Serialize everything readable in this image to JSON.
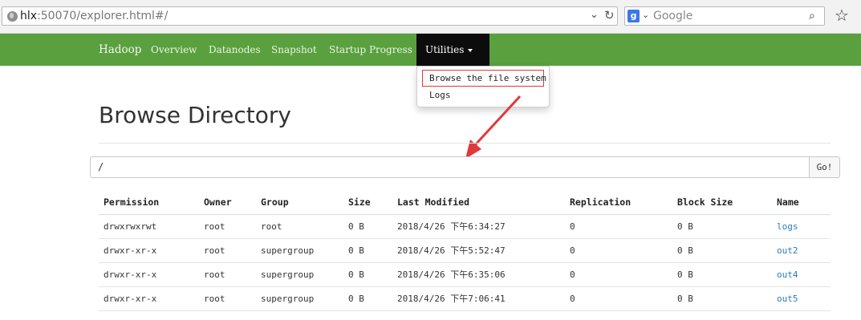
{
  "browser": {
    "url_host": "hlx",
    "url_rest": ":50070/explorer.html#/",
    "search_placeholder": "Google",
    "search_engine_icon": "google-icon"
  },
  "navbar": {
    "brand": "Hadoop",
    "items": [
      {
        "label": "Overview"
      },
      {
        "label": "Datanodes"
      },
      {
        "label": "Snapshot"
      },
      {
        "label": "Startup Progress"
      },
      {
        "label": "Utilities",
        "active": true
      }
    ],
    "color": "#5aa03f"
  },
  "dropdown": {
    "items": [
      {
        "label": "Browse the file system",
        "highlighted": true
      },
      {
        "label": "Logs"
      }
    ]
  },
  "main": {
    "title": "Browse Directory",
    "path_value": "/",
    "go_label": "Go!",
    "columns": [
      "Permission",
      "Owner",
      "Group",
      "Size",
      "Last Modified",
      "Replication",
      "Block Size",
      "Name"
    ],
    "rows": [
      [
        "drwxrwxrwt",
        "root",
        "root",
        "0 B",
        "2018/4/26 下午6:34:27",
        "0",
        "0 B",
        "logs"
      ],
      [
        "drwxr-xr-x",
        "root",
        "supergroup",
        "0 B",
        "2018/4/26 下午5:52:47",
        "0",
        "0 B",
        "out2"
      ],
      [
        "drwxr-xr-x",
        "root",
        "supergroup",
        "0 B",
        "2018/4/26 下午6:35:06",
        "0",
        "0 B",
        "out4"
      ],
      [
        "drwxr-xr-x",
        "root",
        "supergroup",
        "0 B",
        "2018/4/26 下午7:06:41",
        "0",
        "0 B",
        "out5"
      ]
    ]
  },
  "annotation": {
    "arrow_color": "#e0393b",
    "box_color": "#e0393b"
  }
}
